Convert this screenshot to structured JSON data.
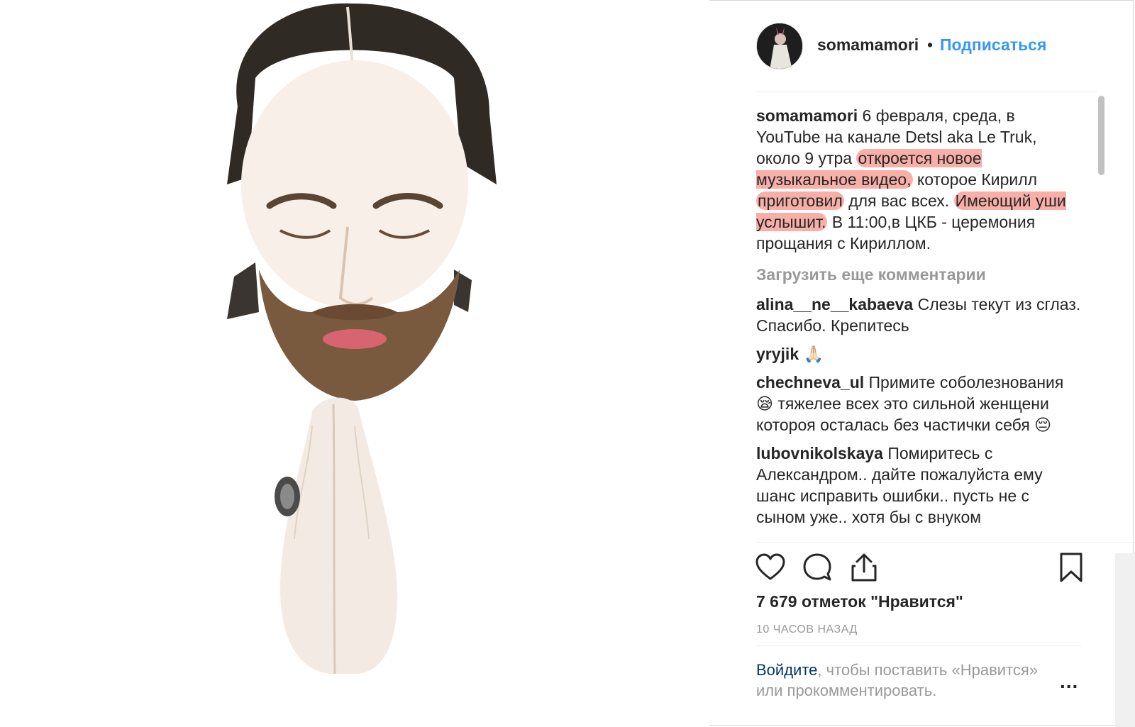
{
  "header": {
    "username": "somamamori",
    "dot": "•",
    "follow_label": "Подписаться"
  },
  "caption": {
    "username": "somamamori",
    "text_1": " 6 февраля, среда, в YouTube на канале Detsl aka Le Truk, около 9 утра ",
    "hl_1": "откроется новое музыкальное видео,",
    "text_2": " которое Кирилл ",
    "hl_2": "приготовил",
    "text_3": " для вас всех. ",
    "hl_3": "Имеющий уши услышит.",
    "text_4": " В 11:00,в ЦКБ - церемония прощания с Кириллом."
  },
  "load_more": "Загрузить еще комментарии",
  "comments": [
    {
      "username": "alina__ne__kabaeva",
      "text": " Слезы текут из сглаз. Спасибо. Крепитесь"
    },
    {
      "username": "yryjik",
      "text": " 🙏🏻"
    },
    {
      "username": "chechneva_ul",
      "text": " Примите соболезнования 😪  тяжелее всех это сильной женщени котороя осталась без частички себя 😔"
    },
    {
      "username": "lubovnikolskaya",
      "text": " Помиритесь с Александром.. дайте пожалуйста ему шанс исправить ошибки.. пусть не с сыном уже.. хотя бы с внуком"
    }
  ],
  "actions": {
    "like_icon": "heart-icon",
    "comment_icon": "comment-icon",
    "share_icon": "share-icon",
    "save_icon": "bookmark-icon"
  },
  "likes": "7 679 отметок \"Нравится\"",
  "timestamp": "10 часов назад",
  "login_prompt": {
    "link": "Войдите",
    "text": ", чтобы поставить «Нравится» или прокомментировать."
  },
  "more_label": "..."
}
